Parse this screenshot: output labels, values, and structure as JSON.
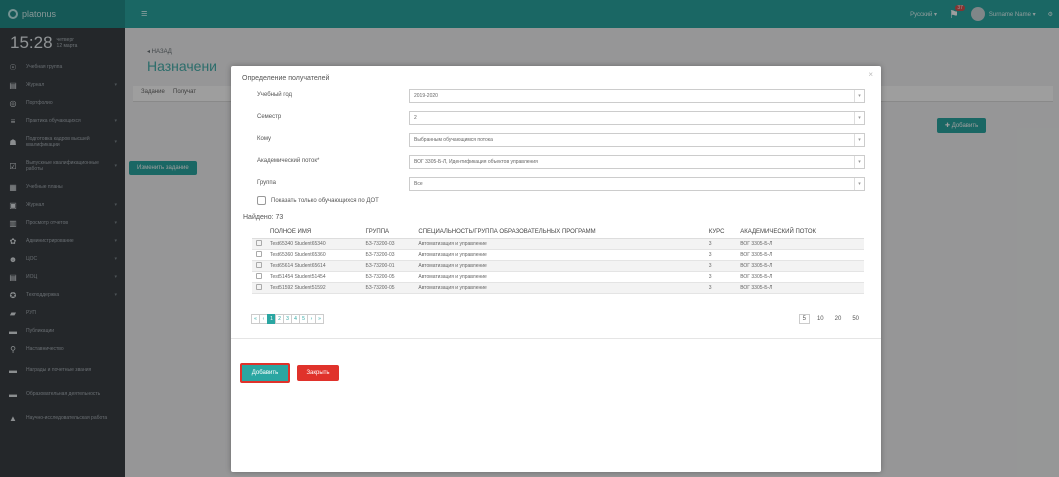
{
  "app": {
    "logo_text": "platonus",
    "hamburger": "≡"
  },
  "topbar": {
    "lang": "Русский ▾",
    "notif_count": "37",
    "user_name": "Surname Name ▾",
    "extra_icon": "⚙"
  },
  "clock": {
    "time": "15:28",
    "weekday": "четверг",
    "date": "12 марта"
  },
  "sidebar": {
    "items": [
      {
        "icon": "people-icon",
        "glyph": "☉",
        "label": "Учебная группа",
        "count": ""
      },
      {
        "icon": "clipboard-icon",
        "glyph": "▤",
        "label": "Журнал",
        "count": "▾"
      },
      {
        "icon": "portfolio-icon",
        "glyph": "◎",
        "label": "Портфолио",
        "count": ""
      },
      {
        "icon": "list-icon",
        "glyph": "≡",
        "label": "Практика обучающихся",
        "count": "▾"
      },
      {
        "icon": "graduation-icon",
        "glyph": "☗",
        "label": "Подготовка кадров высшей квалификации",
        "count": "▾"
      },
      {
        "icon": "certificate-icon",
        "glyph": "☑",
        "label": "Выпускные квалификационные работы",
        "count": "▾"
      },
      {
        "icon": "table-icon",
        "glyph": "▦",
        "label": "Учебные планы",
        "count": ""
      },
      {
        "icon": "journal-icon",
        "glyph": "▣",
        "label": "Журнал",
        "count": "▾"
      },
      {
        "icon": "report-icon",
        "glyph": "▥",
        "label": "Просмотр отчетов",
        "count": "▾"
      },
      {
        "icon": "settings-icon",
        "glyph": "✿",
        "label": "Администрирование",
        "count": "▾"
      },
      {
        "icon": "user-icon",
        "glyph": "☻",
        "label": "ЦОС",
        "count": "▾"
      },
      {
        "icon": "folder-icon",
        "glyph": "▤",
        "label": "ИОЦ",
        "count": "▾"
      },
      {
        "icon": "support-icon",
        "glyph": "✪",
        "label": "Техподдержка",
        "count": "▾"
      },
      {
        "icon": "tag-icon",
        "glyph": "▰",
        "label": "РУП",
        "count": ""
      },
      {
        "icon": "book-icon",
        "glyph": "▬",
        "label": "Публикации",
        "count": ""
      },
      {
        "icon": "hierarchy-icon",
        "glyph": "⚲",
        "label": "Наставничество",
        "count": ""
      },
      {
        "icon": "award-icon",
        "glyph": "▬",
        "label": "Награды и почетные звания",
        "count": ""
      },
      {
        "icon": "education-icon",
        "glyph": "▬",
        "label": "Образовательная деятельность",
        "count": ""
      },
      {
        "icon": "research-icon",
        "glyph": "▲",
        "label": "Научно-исследовательская работа",
        "count": ""
      }
    ]
  },
  "main": {
    "crumb": "◂ НАЗАД",
    "title": "Назначени",
    "tabs": [
      "Задание",
      "Получат"
    ],
    "add_button": "✚ Добавить",
    "change_task_button": "Изменить задание"
  },
  "modal": {
    "title": "Определение получателей",
    "close": "×",
    "fields": [
      {
        "label": "Учебный год",
        "value": "2019-2020"
      },
      {
        "label": "Семестр",
        "value": "2"
      },
      {
        "label": "Кому",
        "value": "Выбранным обучающимся потока"
      },
      {
        "label": "Академический поток*",
        "value": "ВОГ 3305-Б-Л, Идентификация объектов управления"
      },
      {
        "label": "Группа",
        "value": "Все"
      }
    ],
    "dropdown_arrow": "▾",
    "checkbox_label": "Показать только обучающихся по ДОТ",
    "found_label": "Найдено: 73",
    "table": {
      "headers": [
        "ПОЛНОЕ ИМЯ",
        "ГРУППА",
        "СПЕЦИАЛЬНОСТЬ/ГРУППА ОБРАЗОВАТЕЛЬНЫХ ПРОГРАММ",
        "КУРС",
        "АКАДЕМИЧЕСКИЙ ПОТОК"
      ],
      "rows": [
        [
          "Test65340 Student65340",
          "БЗ-73200-03",
          "Автоматизация и управление",
          "3",
          "ВОГ 3305-Б-Л"
        ],
        [
          "Test65360 Student65360",
          "БЗ-73200-03",
          "Автоматизация и управление",
          "3",
          "ВОГ 3305-Б-Л"
        ],
        [
          "Test65614 Student65614",
          "БЗ-73200-01",
          "Автоматизация и управление",
          "3",
          "ВОГ 3305-Б-Л"
        ],
        [
          "Test51454 Student51454",
          "БЗ-73200-05",
          "Автоматизация и управление",
          "3",
          "ВОГ 3305-Б-Л"
        ],
        [
          "Test51592 Student51592",
          "БЗ-73200-05",
          "Автоматизация и управление",
          "3",
          "ВОГ 3305-Б-Л"
        ]
      ]
    },
    "pager": [
      "«",
      "‹",
      "1",
      "2",
      "3",
      "4",
      "5",
      "›",
      "»"
    ],
    "pager_active": "1",
    "page_sizes": [
      "5",
      "10",
      "20",
      "50"
    ],
    "page_size_selected": "5",
    "add_button": "Добавить",
    "close_button": "Закрыть"
  },
  "colors": {
    "accent": "#2aa6a2",
    "danger": "#e0322b",
    "sidebar": "#3a3f44"
  }
}
